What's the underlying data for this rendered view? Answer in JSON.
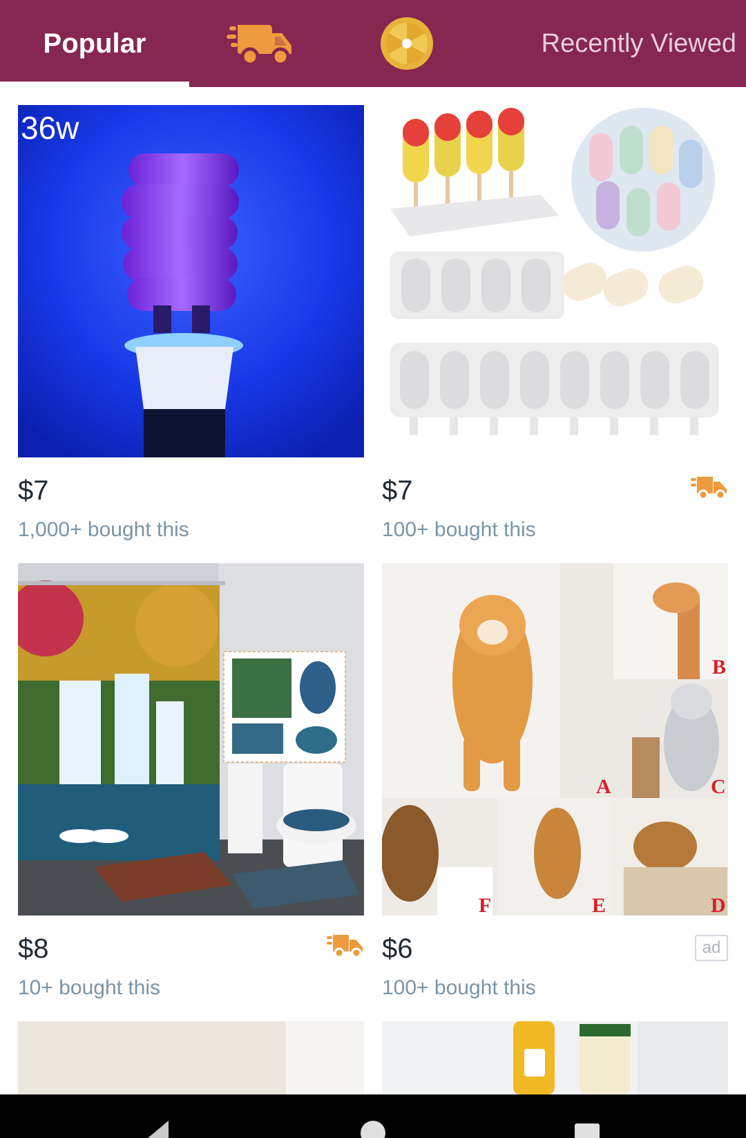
{
  "tabs": {
    "popular": "Popular",
    "recently_viewed": "Recently Viewed"
  },
  "products": [
    {
      "image_label": "36w",
      "price": "$7",
      "bought": "1,000+ bought this",
      "badge": ""
    },
    {
      "image_label": "",
      "price": "$7",
      "bought": "100+ bought this",
      "badge": "shipping"
    },
    {
      "image_label": "",
      "price": "$8",
      "bought": "10+ bought this",
      "badge": "shipping"
    },
    {
      "image_label": "",
      "price": "$6",
      "bought": "100+ bought this",
      "badge": "ad",
      "ad_text": "ad"
    }
  ],
  "decal_letters": [
    "A",
    "B",
    "C",
    "D",
    "E",
    "F"
  ],
  "colors": {
    "header": "#852751",
    "shipping_icon": "#ee9a3e",
    "wheel_icon": "#e7b33b",
    "price_text": "#1f2a33",
    "bought_text": "#7a94a8"
  }
}
